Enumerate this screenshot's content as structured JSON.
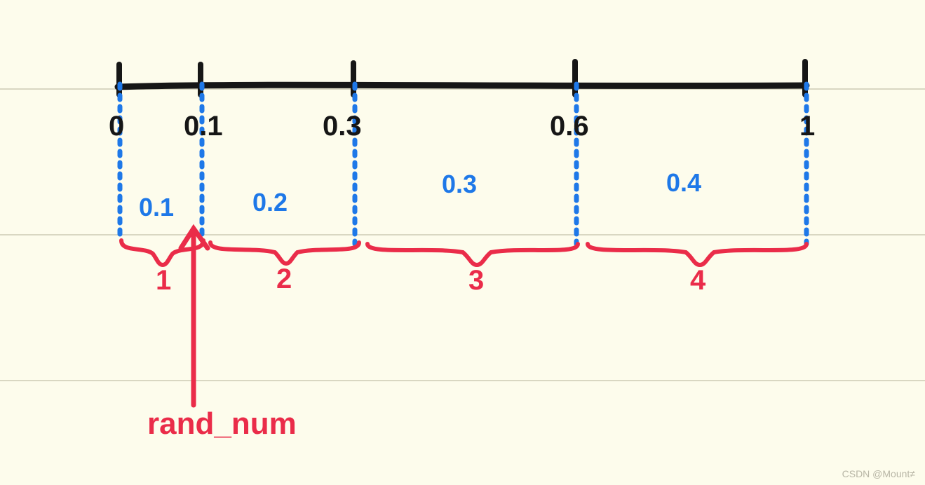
{
  "chart_data": {
    "type": "line",
    "title": "",
    "xlabel": "",
    "ylabel": "",
    "xlim": [
      0,
      1
    ],
    "tick_positions": [
      0,
      0.1,
      0.3,
      0.6,
      1
    ],
    "tick_labels": [
      "0",
      "0.1",
      "0.3",
      "0.6",
      "1"
    ],
    "series": [
      {
        "name": "1",
        "width": 0.1,
        "range": [
          0,
          0.1
        ]
      },
      {
        "name": "2",
        "width": 0.2,
        "range": [
          0.1,
          0.3
        ]
      },
      {
        "name": "3",
        "width": 0.3,
        "range": [
          0.3,
          0.6
        ]
      },
      {
        "name": "4",
        "width": 0.4,
        "range": [
          0.6,
          1
        ]
      }
    ],
    "segment_value_labels": [
      "0.1",
      "0.2",
      "0.3",
      "0.4"
    ],
    "pointer_label": "rand_num"
  },
  "ticks": {
    "t0": "0",
    "t1": "0.1",
    "t2": "0.3",
    "t3": "0.6",
    "t4": "1"
  },
  "widths": {
    "w1": "0.1",
    "w2": "0.2",
    "w3": "0.3",
    "w4": "0.4"
  },
  "segments": {
    "s1": "1",
    "s2": "2",
    "s3": "3",
    "s4": "4"
  },
  "pointer": {
    "label": "rand_num"
  },
  "watermark": "CSDN @Mount≠"
}
